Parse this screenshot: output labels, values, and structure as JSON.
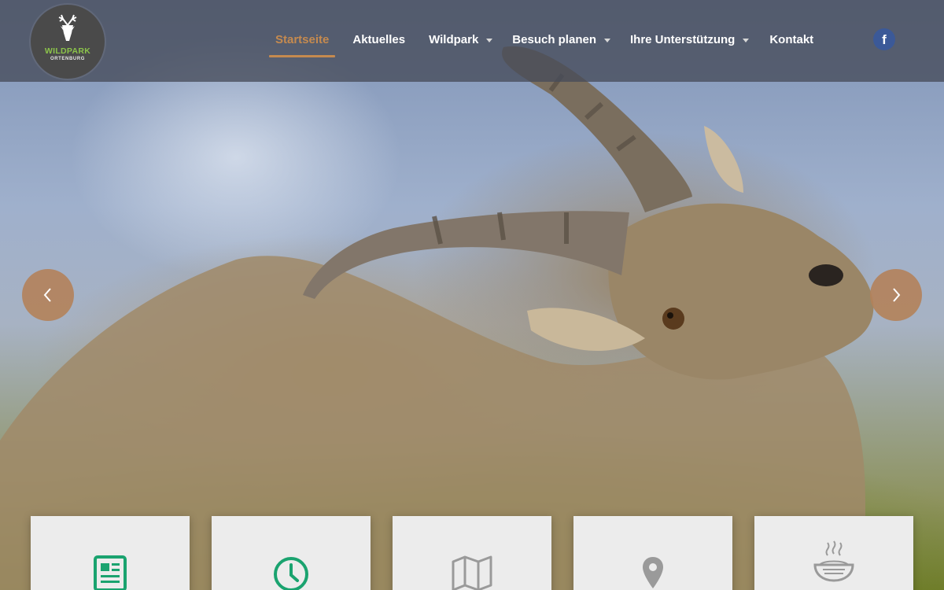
{
  "logo": {
    "title": "WILDPARK",
    "subtitle": "ORTENBURG"
  },
  "nav": {
    "items": [
      {
        "label": "Startseite",
        "active": true,
        "dropdown": false
      },
      {
        "label": "Aktuelles",
        "active": false,
        "dropdown": false
      },
      {
        "label": "Wildpark",
        "active": false,
        "dropdown": true
      },
      {
        "label": "Besuch planen",
        "active": false,
        "dropdown": true
      },
      {
        "label": "Ihre Unterstützung",
        "active": false,
        "dropdown": true
      },
      {
        "label": "Kontakt",
        "active": false,
        "dropdown": false
      }
    ],
    "facebook_glyph": "f"
  },
  "slider": {
    "prev_icon": "chevron-left-icon",
    "next_icon": "chevron-right-icon"
  },
  "cards": [
    {
      "icon": "news-icon",
      "color": "#1aa36f"
    },
    {
      "icon": "clock-icon",
      "color": "#1aa36f"
    },
    {
      "icon": "map-icon",
      "color": "#9a9a9a"
    },
    {
      "icon": "location-pin-icon",
      "color": "#9a9a9a"
    },
    {
      "icon": "food-bowl-icon",
      "color": "#9a9a9a"
    }
  ],
  "colors": {
    "accent": "#c58a4f",
    "facebook": "#3b5998",
    "logo_green": "#8bc34a"
  }
}
